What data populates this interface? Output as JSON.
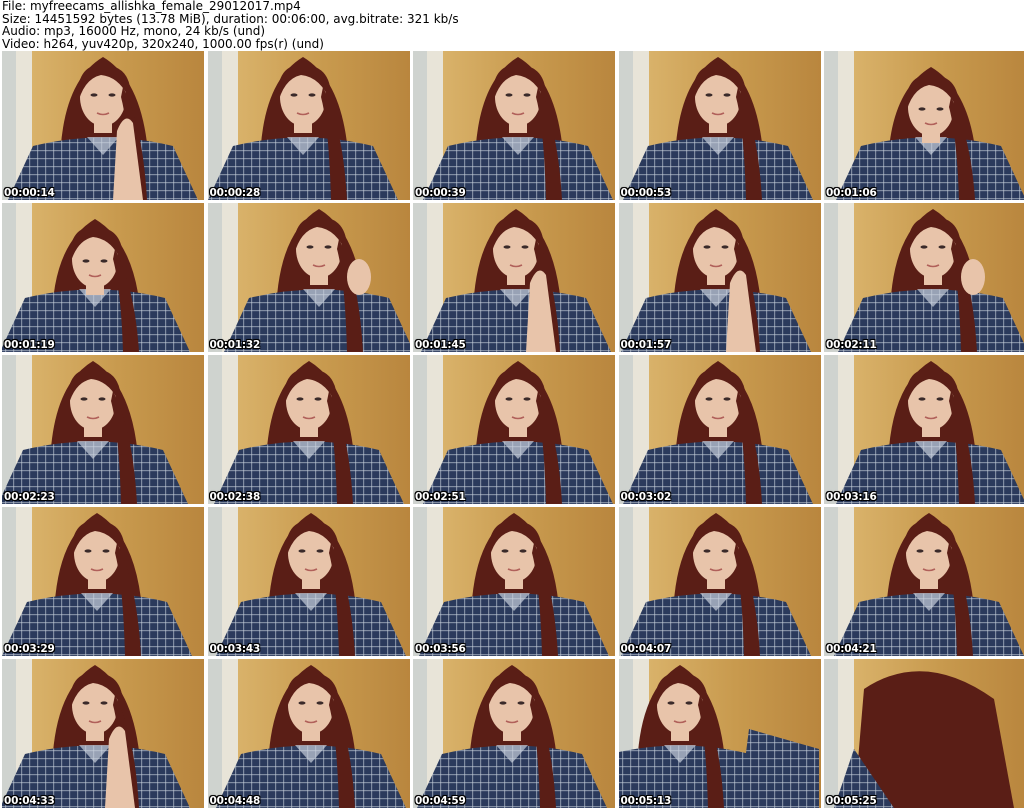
{
  "header": {
    "file_line": "File: myfreecams_allishka_female_29012017.mp4",
    "size_line": "Size: 14451592 bytes (13.78 MiB), duration: 00:06:00, avg.bitrate: 321 kb/s",
    "audio_line": "Audio: mp3, 16000 Hz, mono, 24 kb/s (und)",
    "video_line": "Video: h264, yuv420p, 320x240, 1000.00 fps(r) (und)"
  },
  "thumbnails": [
    {
      "timestamp": "00:00:14",
      "pose": "hand-chin"
    },
    {
      "timestamp": "00:00:28",
      "pose": "neutral"
    },
    {
      "timestamp": "00:00:39",
      "pose": "neutral"
    },
    {
      "timestamp": "00:00:53",
      "pose": "neutral"
    },
    {
      "timestamp": "00:01:06",
      "pose": "head-down"
    },
    {
      "timestamp": "00:01:19",
      "pose": "head-down"
    },
    {
      "timestamp": "00:01:32",
      "pose": "hand-hair"
    },
    {
      "timestamp": "00:01:45",
      "pose": "hand-chin"
    },
    {
      "timestamp": "00:01:57",
      "pose": "hand-chin"
    },
    {
      "timestamp": "00:02:11",
      "pose": "hand-hair"
    },
    {
      "timestamp": "00:02:23",
      "pose": "tilted"
    },
    {
      "timestamp": "00:02:38",
      "pose": "neutral"
    },
    {
      "timestamp": "00:02:51",
      "pose": "neutral"
    },
    {
      "timestamp": "00:03:02",
      "pose": "neutral"
    },
    {
      "timestamp": "00:03:16",
      "pose": "neutral"
    },
    {
      "timestamp": "00:03:29",
      "pose": "neutral"
    },
    {
      "timestamp": "00:03:43",
      "pose": "neutral"
    },
    {
      "timestamp": "00:03:56",
      "pose": "neutral"
    },
    {
      "timestamp": "00:04:07",
      "pose": "neutral"
    },
    {
      "timestamp": "00:04:21",
      "pose": "neutral"
    },
    {
      "timestamp": "00:04:33",
      "pose": "hand-chin"
    },
    {
      "timestamp": "00:04:48",
      "pose": "neutral"
    },
    {
      "timestamp": "00:04:59",
      "pose": "neutral"
    },
    {
      "timestamp": "00:05:13",
      "pose": "leaning"
    },
    {
      "timestamp": "00:05:25",
      "pose": "hair-only"
    }
  ],
  "colors": {
    "door": "#c89a4e",
    "wall": "#e8e4d8",
    "hair": "#5a1e16",
    "skin": "#e8c4aa",
    "shirt": "#2b3a5c",
    "shirt_check": "#c7cfdb",
    "timestamp_text": "#ffffff"
  }
}
